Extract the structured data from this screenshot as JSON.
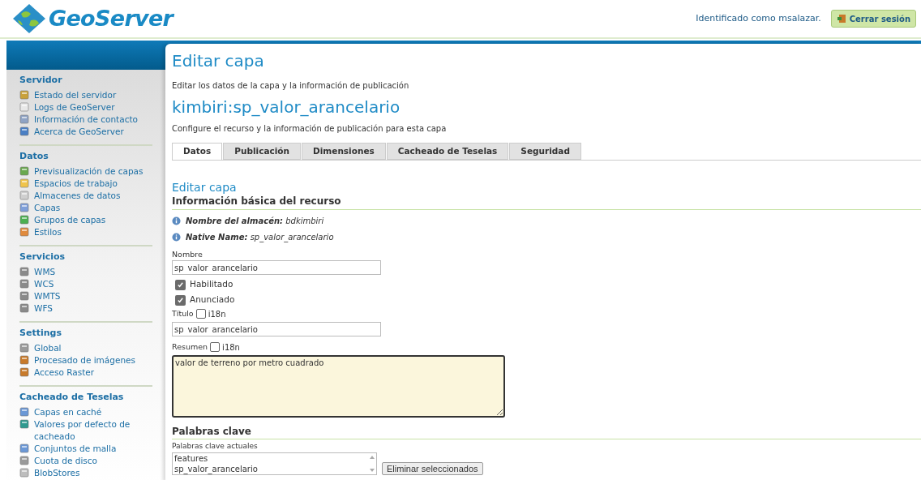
{
  "header": {
    "logo": "GeoServer",
    "user_text": "Identificado como msalazar.",
    "logout_button": "Cerrar sesión"
  },
  "sidebar": {
    "sections": [
      {
        "title": "Servidor",
        "items": [
          "Estado del servidor",
          "Logs de GeoServer",
          "Información de contacto",
          "Acerca de GeoServer"
        ]
      },
      {
        "title": "Datos",
        "items": [
          "Previsualización de capas",
          "Espacios de trabajo",
          "Almacenes de datos",
          "Capas",
          "Grupos de capas",
          "Estilos"
        ]
      },
      {
        "title": "Servicios",
        "items": [
          "WMS",
          "WCS",
          "WMTS",
          "WFS"
        ]
      },
      {
        "title": "Settings",
        "items": [
          "Global",
          "Procesado de imágenes",
          "Acceso Raster"
        ]
      },
      {
        "title": "Cacheado de Teselas",
        "items": [
          "Capas en caché",
          "Valores por defecto de cacheado",
          "Conjuntos de malla",
          "Cuota de disco",
          "BlobStores"
        ]
      }
    ]
  },
  "page": {
    "title": "Editar capa",
    "subtitle": "Editar los datos de la capa y la información de publicación",
    "layer_name": "kimbiri:sp_valor_arancelario",
    "description": "Configure el recurso y la información de publicación para esta capa"
  },
  "tabs": [
    {
      "label": "Datos",
      "selected": true
    },
    {
      "label": "Publicación",
      "selected": false
    },
    {
      "label": "Dimensiones",
      "selected": false
    },
    {
      "label": "Cacheado de Teselas",
      "selected": false
    },
    {
      "label": "Seguridad",
      "selected": false
    }
  ],
  "form": {
    "heading": "Editar capa",
    "section_title": "Información básica del recurso",
    "info": [
      {
        "label": "Nombre del almacén:",
        "value": "bdkimbiri"
      },
      {
        "label": "Native Name:",
        "value": "sp_valor_arancelario"
      }
    ],
    "name_label": "Nombre",
    "name_value": "sp_valor_arancelario",
    "checkboxes": [
      {
        "label": "Habilitado",
        "checked": true
      },
      {
        "label": "Anunciado",
        "checked": true
      }
    ],
    "title_label": "Título",
    "title_i18n": {
      "label": "i18n",
      "checked": false
    },
    "title_value": "sp_valor_arancelario",
    "abstract_label": "Resumen",
    "abstract_i18n": {
      "label": "i18n",
      "checked": false
    },
    "abstract_value": "valor de terreno por metro cuadrado",
    "keywords_title": "Palabras clave",
    "keywords_label": "Palabras clave actuales",
    "keywords": [
      "features",
      "sp_valor_arancelario"
    ],
    "remove_button": "Eliminar seleccionados"
  }
}
